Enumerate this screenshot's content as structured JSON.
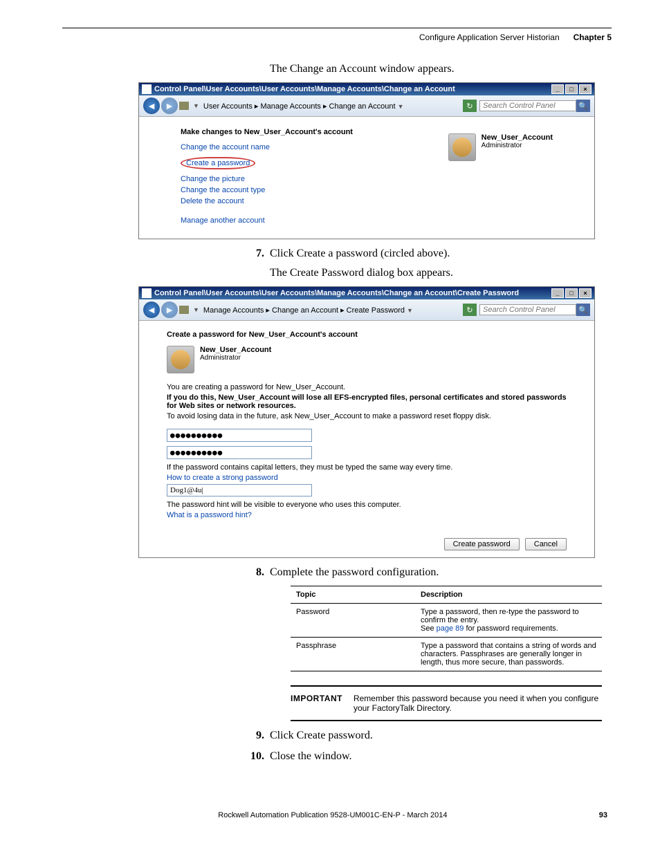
{
  "header": {
    "title": "Configure Application Server Historian",
    "chapter": "Chapter 5"
  },
  "intro1": "The Change an Account window appears.",
  "win1": {
    "titlebar": "Control Panel\\User Accounts\\User Accounts\\Manage Accounts\\Change an Account",
    "breadcrumb": "User Accounts  ▸  Manage Accounts  ▸  Change an Account",
    "search_placeholder": "Search Control Panel",
    "heading": "Make changes to New_User_Account's account",
    "links": {
      "change_name": "Change the account name",
      "create_pw": "Create a password",
      "change_pic": "Change the picture",
      "change_type": "Change the account type",
      "delete": "Delete the account",
      "manage_another": "Manage another account"
    },
    "account_name": "New_User_Account",
    "account_role": "Administrator"
  },
  "step7": {
    "num": "7.",
    "text": "Click Create a password (circled above)."
  },
  "intro2": "The Create Password dialog box appears.",
  "win2": {
    "titlebar": "Control Panel\\User Accounts\\User Accounts\\Manage Accounts\\Change an Account\\Create Password",
    "breadcrumb": "Manage Accounts  ▸  Change an Account  ▸  Create Password",
    "search_placeholder": "Search Control Panel",
    "heading": "Create a password for New_User_Account's account",
    "account_name": "New_User_Account",
    "account_role": "Administrator",
    "line1": "You are creating a password for New_User_Account.",
    "line2": "If you do this, New_User_Account will lose all EFS-encrypted files, personal certificates and stored passwords for Web sites or network resources.",
    "line3": "To avoid losing data in the future, ask New_User_Account to make a password reset floppy disk.",
    "pw1": "●●●●●●●●●●",
    "pw2": "●●●●●●●●●●",
    "caps_note": "If the password contains capital letters, they must be typed the same way every time.",
    "strong_link": "How to create a strong password",
    "hint_value": "Dog1@4u|",
    "hint_note": "The password hint will be visible to everyone who uses this computer.",
    "hint_link": "What is a password hint?",
    "btn_create": "Create password",
    "btn_cancel": "Cancel"
  },
  "step8": {
    "num": "8.",
    "text": "Complete the password configuration."
  },
  "table": {
    "h1": "Topic",
    "h2": "Description",
    "r1c1": "Password",
    "r1c2a": "Type a password, then re-type the password to confirm the entry.",
    "r1c2b_pre": "See ",
    "r1c2b_link": "page 89",
    "r1c2b_post": " for password requirements.",
    "r2c1": "Passphrase",
    "r2c2": "Type a password that contains a string of words and characters. Passphrases are generally longer in length, thus more secure, than passwords."
  },
  "important": {
    "label": "IMPORTANT",
    "text": "Remember this password because you need it when you configure your FactoryTalk Directory."
  },
  "step9": {
    "num": "9.",
    "text": "Click Create password."
  },
  "step10": {
    "num": "10.",
    "text": "Close the window."
  },
  "footer": {
    "pub": "Rockwell Automation Publication 9528-UM001C-EN-P - March 2014",
    "page": "93"
  }
}
